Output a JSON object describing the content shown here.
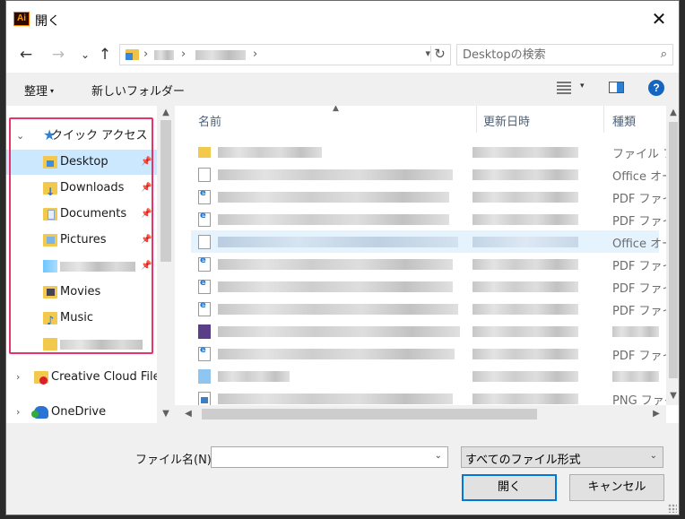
{
  "window": {
    "title": "開く",
    "app_icon_text": "Ai"
  },
  "nav": {
    "back": "←",
    "forward": "→",
    "recent": "⌄",
    "up": "↑",
    "refresh": "↻",
    "search_placeholder": "Desktopの検索"
  },
  "toolbar": {
    "organize": "整理",
    "new_folder": "新しいフォルダー",
    "help": "?"
  },
  "sidebar": {
    "quick_access": "クイック アクセス",
    "items": [
      {
        "label": "Desktop",
        "icon": "desktop-folder-icon"
      },
      {
        "label": "Downloads",
        "icon": "downloads-folder-icon"
      },
      {
        "label": "Documents",
        "icon": "documents-folder-icon"
      },
      {
        "label": "Pictures",
        "icon": "pictures-folder-icon"
      },
      {
        "label": "Movies",
        "icon": "movies-folder-icon"
      },
      {
        "label": "Music",
        "icon": "music-folder-icon"
      }
    ],
    "creative_cloud": "Creative Cloud File",
    "onedrive": "OneDrive"
  },
  "columns": {
    "name": "名前",
    "modified": "更新日時",
    "type": "種類"
  },
  "files": [
    {
      "type": "ファイル フォ"
    },
    {
      "type": "Office オー"
    },
    {
      "type": "PDF ファイル"
    },
    {
      "type": "PDF ファイル"
    },
    {
      "type": "Office オー"
    },
    {
      "type": "PDF ファイル"
    },
    {
      "type": "PDF ファイル"
    },
    {
      "type": "PDF ファイル"
    },
    {
      "type": ""
    },
    {
      "type": "PDF ファイル"
    },
    {
      "type": ""
    },
    {
      "type": "PNG ファイル"
    }
  ],
  "bottom": {
    "filename_label": "ファイル名(N):",
    "filename_value": "",
    "filetype": "すべてのファイル形式",
    "open_button": "開く",
    "cancel_button": "キャンセル"
  }
}
